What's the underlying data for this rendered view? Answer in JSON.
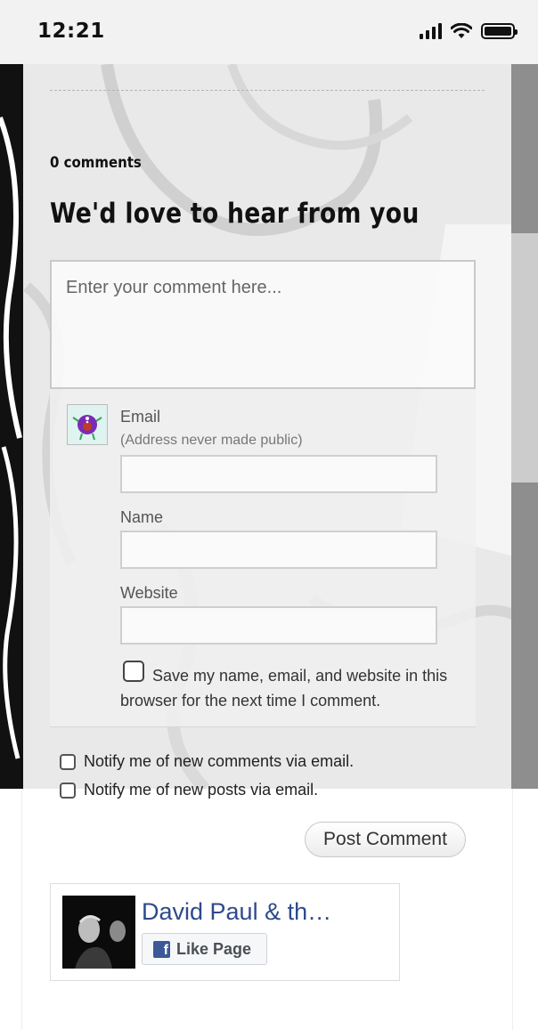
{
  "status_bar": {
    "time": "12:21"
  },
  "comments": {
    "count_label": "0 comments",
    "heading": "We'd love to hear from you",
    "comment_placeholder": "Enter your comment here...",
    "email_label": "Email",
    "email_hint": "(Address never made public)",
    "name_label": "Name",
    "website_label": "Website",
    "save_info_label": "Save my name, email, and website in this browser for the next time I comment.",
    "notify_comments_label": "Notify me of new comments via email.",
    "notify_posts_label": "Notify me of new posts via email.",
    "post_button_label": "Post Comment"
  },
  "facebook_widget": {
    "page_name": "David Paul & th…",
    "like_label": "Like Page",
    "logo_glyph": "f"
  },
  "colors": {
    "fb_blue": "#3b5998",
    "fb_name_link": "#2e4a8c"
  }
}
